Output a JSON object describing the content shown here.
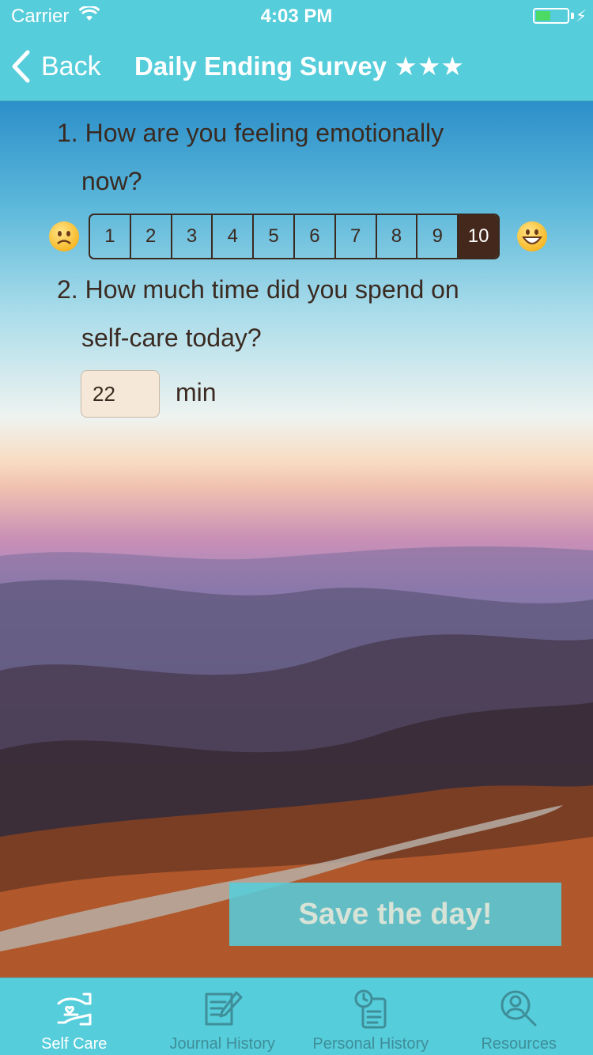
{
  "status_bar": {
    "carrier": "Carrier",
    "time": "4:03 PM"
  },
  "nav": {
    "back_label": "Back",
    "title": "Daily Ending Survey ★★★"
  },
  "survey": {
    "q1": {
      "line1": "1. How are you feeling emotionally",
      "line2": "now?"
    },
    "scale": [
      "1",
      "2",
      "3",
      "4",
      "5",
      "6",
      "7",
      "8",
      "9",
      "10"
    ],
    "scale_selected": "10",
    "q2": {
      "line1": "2. How much time did you spend on",
      "line2": "self-care today?"
    },
    "time_value": "22",
    "time_unit": "min"
  },
  "save_label": "Save the day!",
  "tabs": [
    {
      "label": "Self Care",
      "icon": "hands-heart-icon",
      "active": true
    },
    {
      "label": "Journal History",
      "icon": "journal-edit-icon",
      "active": false
    },
    {
      "label": "Personal History",
      "icon": "clock-document-icon",
      "active": false
    },
    {
      "label": "Resources",
      "icon": "person-search-icon",
      "active": false
    }
  ],
  "colors": {
    "accent": "#56cdda",
    "selected": "#44281c",
    "input_bg": "#f6e8d9"
  }
}
